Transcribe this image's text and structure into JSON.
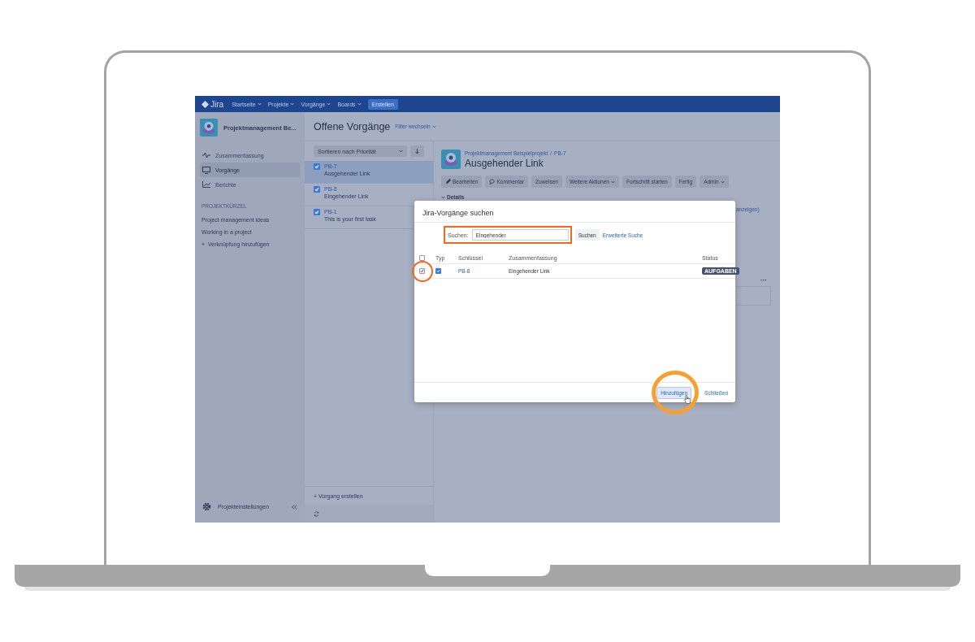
{
  "nav": {
    "logo": "Jira",
    "items": [
      {
        "label": "Startseite"
      },
      {
        "label": "Projekte"
      },
      {
        "label": "Vorgänge"
      },
      {
        "label": "Boards"
      }
    ],
    "create": "Erstellen"
  },
  "sidebar": {
    "project": "Projektmanagement Be...",
    "items": [
      {
        "label": "Zusammenfassung",
        "kind": "pulse",
        "selected": false
      },
      {
        "label": "Vorgänge",
        "kind": "monitor",
        "selected": true
      },
      {
        "label": "Berichte",
        "kind": "chart",
        "selected": false
      }
    ],
    "section_title": "PROJEKTKÜRZEL",
    "shortcuts": [
      "Project management ideas",
      "Working in a project"
    ],
    "add_icon": "+",
    "add_link": "Verknüpfung hinzufügen",
    "settings": "Projekteinstellungen"
  },
  "list": {
    "title": "Offene Vorgänge",
    "filter": "Filter wechseln",
    "sort": "Sortieren nach Priorität",
    "issues": [
      {
        "key": "PB-7",
        "summary": "Ausgehender Link",
        "selected": true
      },
      {
        "key": "PB-8",
        "summary": "Eingehender Link",
        "selected": false
      },
      {
        "key": "PB-1",
        "summary": "This is your first task",
        "selected": false
      }
    ],
    "create_icon": "+",
    "create": "Vorgang erstellen"
  },
  "detail": {
    "breadcrumb": [
      "Projektmanagement Beispielprojekt",
      "/",
      "PB-7"
    ],
    "title": "Ausgehender Link",
    "actions": [
      {
        "label": "Bearbeiten",
        "kind": "pencil"
      },
      {
        "label": "Kommentar",
        "kind": "comment"
      },
      {
        "label": "Zuweisen",
        "kind": "plain"
      },
      {
        "label": "Weitere Aktionen",
        "kind": "menu"
      },
      {
        "label": "Fortschritt starten",
        "kind": "plain"
      },
      {
        "label": "Fertig",
        "kind": "plain"
      },
      {
        "label": "Admin",
        "kind": "menu"
      }
    ],
    "details": "Details",
    "fragment": "anzeigen)",
    "more": "···"
  },
  "dialog": {
    "title": "Jira-Vorgänge suchen",
    "search_label": "Suchen:",
    "search_value": "Eingehender",
    "search_button": "Suchen",
    "advanced": "Erweiterte Suche",
    "header_checked": false,
    "columns": [
      "Typ",
      "Schlüssel",
      "Zusammenfassung",
      "Status"
    ],
    "rows": [
      {
        "checked": true,
        "key": "PB-8",
        "summary": "Eingehender Link",
        "status": "AUFGABEN"
      }
    ],
    "buttons": [
      {
        "label": "Hinzufügen",
        "kind": "primary"
      },
      {
        "label": "Schließen",
        "kind": "link"
      }
    ]
  }
}
